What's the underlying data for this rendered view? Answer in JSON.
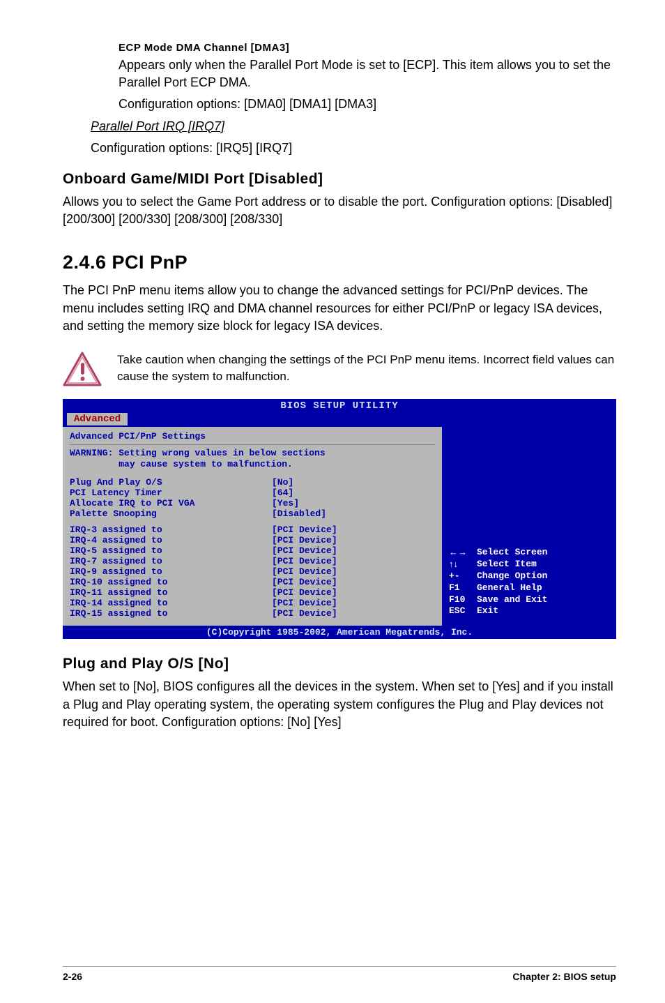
{
  "sec1": {
    "title": "ECP Mode DMA Channel [DMA3]",
    "body1": "Appears only when the Parallel Port Mode is set to [ECP]. This item allows you to set the Parallel Port ECP DMA.",
    "body2": "Configuration options: [DMA0] [DMA1] [DMA3]"
  },
  "sec2": {
    "title": "Parallel Port IRQ [IRQ7]",
    "body": "Configuration options: [IRQ5] [IRQ7]"
  },
  "sec3": {
    "title": "Onboard Game/MIDI Port [Disabled]",
    "body": "Allows you to select the Game Port address or to disable the port. Configuration options: [Disabled] [200/300] [200/330] [208/300] [208/330]"
  },
  "sec4": {
    "title": "2.4.6   PCI PnP",
    "body": "The PCI PnP menu items allow you to change the advanced settings for PCI/PnP devices. The menu includes setting IRQ and DMA channel resources for either PCI/PnP or legacy ISA devices, and setting the memory size block for legacy ISA devices."
  },
  "note": "Take caution when changing the settings of the PCI PnP menu items. Incorrect field values can cause the system to malfunction.",
  "bios": {
    "title": "BIOS SETUP UTILITY",
    "tab": "Advanced",
    "heading": "Advanced PCI/PnP Settings",
    "warning1": "WARNING: Setting wrong values in below sections",
    "warning2": "         may cause system to malfunction.",
    "group1": [
      {
        "label": "Plug And Play O/S",
        "value": "[No]"
      },
      {
        "label": "PCI Latency Timer",
        "value": "[64]"
      },
      {
        "label": "Allocate IRQ to PCI VGA",
        "value": "[Yes]"
      },
      {
        "label": "Palette Snooping",
        "value": "[Disabled]"
      }
    ],
    "group2": [
      {
        "label": "IRQ-3 assigned to",
        "value": "[PCI Device]"
      },
      {
        "label": "IRQ-4 assigned to",
        "value": "[PCI Device]"
      },
      {
        "label": "IRQ-5 assigned to",
        "value": "[PCI Device]"
      },
      {
        "label": "IRQ-7 assigned to",
        "value": "[PCI Device]"
      },
      {
        "label": "IRQ-9 assigned to",
        "value": "[PCI Device]"
      },
      {
        "label": "IRQ-10 assigned to",
        "value": "[PCI Device]"
      },
      {
        "label": "IRQ-11 assigned to",
        "value": "[PCI Device]"
      },
      {
        "label": "IRQ-14 assigned to",
        "value": "[PCI Device]"
      },
      {
        "label": "IRQ-15 assigned to",
        "value": "[PCI Device]"
      }
    ],
    "help": [
      {
        "key": "←→",
        "text": "Select Screen"
      },
      {
        "key": "↑↓",
        "text": "Select Item"
      },
      {
        "key": "+-",
        "text": "Change Option"
      },
      {
        "key": "F1",
        "text": "General Help"
      },
      {
        "key": "F10",
        "text": "Save and Exit"
      },
      {
        "key": "ESC",
        "text": "Exit"
      }
    ],
    "footer": "(C)Copyright 1985-2002, American Megatrends, Inc."
  },
  "sec5": {
    "title": "Plug and Play O/S [No]",
    "body": "When set to [No], BIOS configures all the devices in the system. When set to [Yes] and if you install a Plug and Play operating system, the operating system configures the Plug and Play devices not required for boot. Configuration options: [No] [Yes]"
  },
  "footer": {
    "left": "2-26",
    "right_label": "Chapter 2:",
    "right_text": " BIOS setup"
  }
}
